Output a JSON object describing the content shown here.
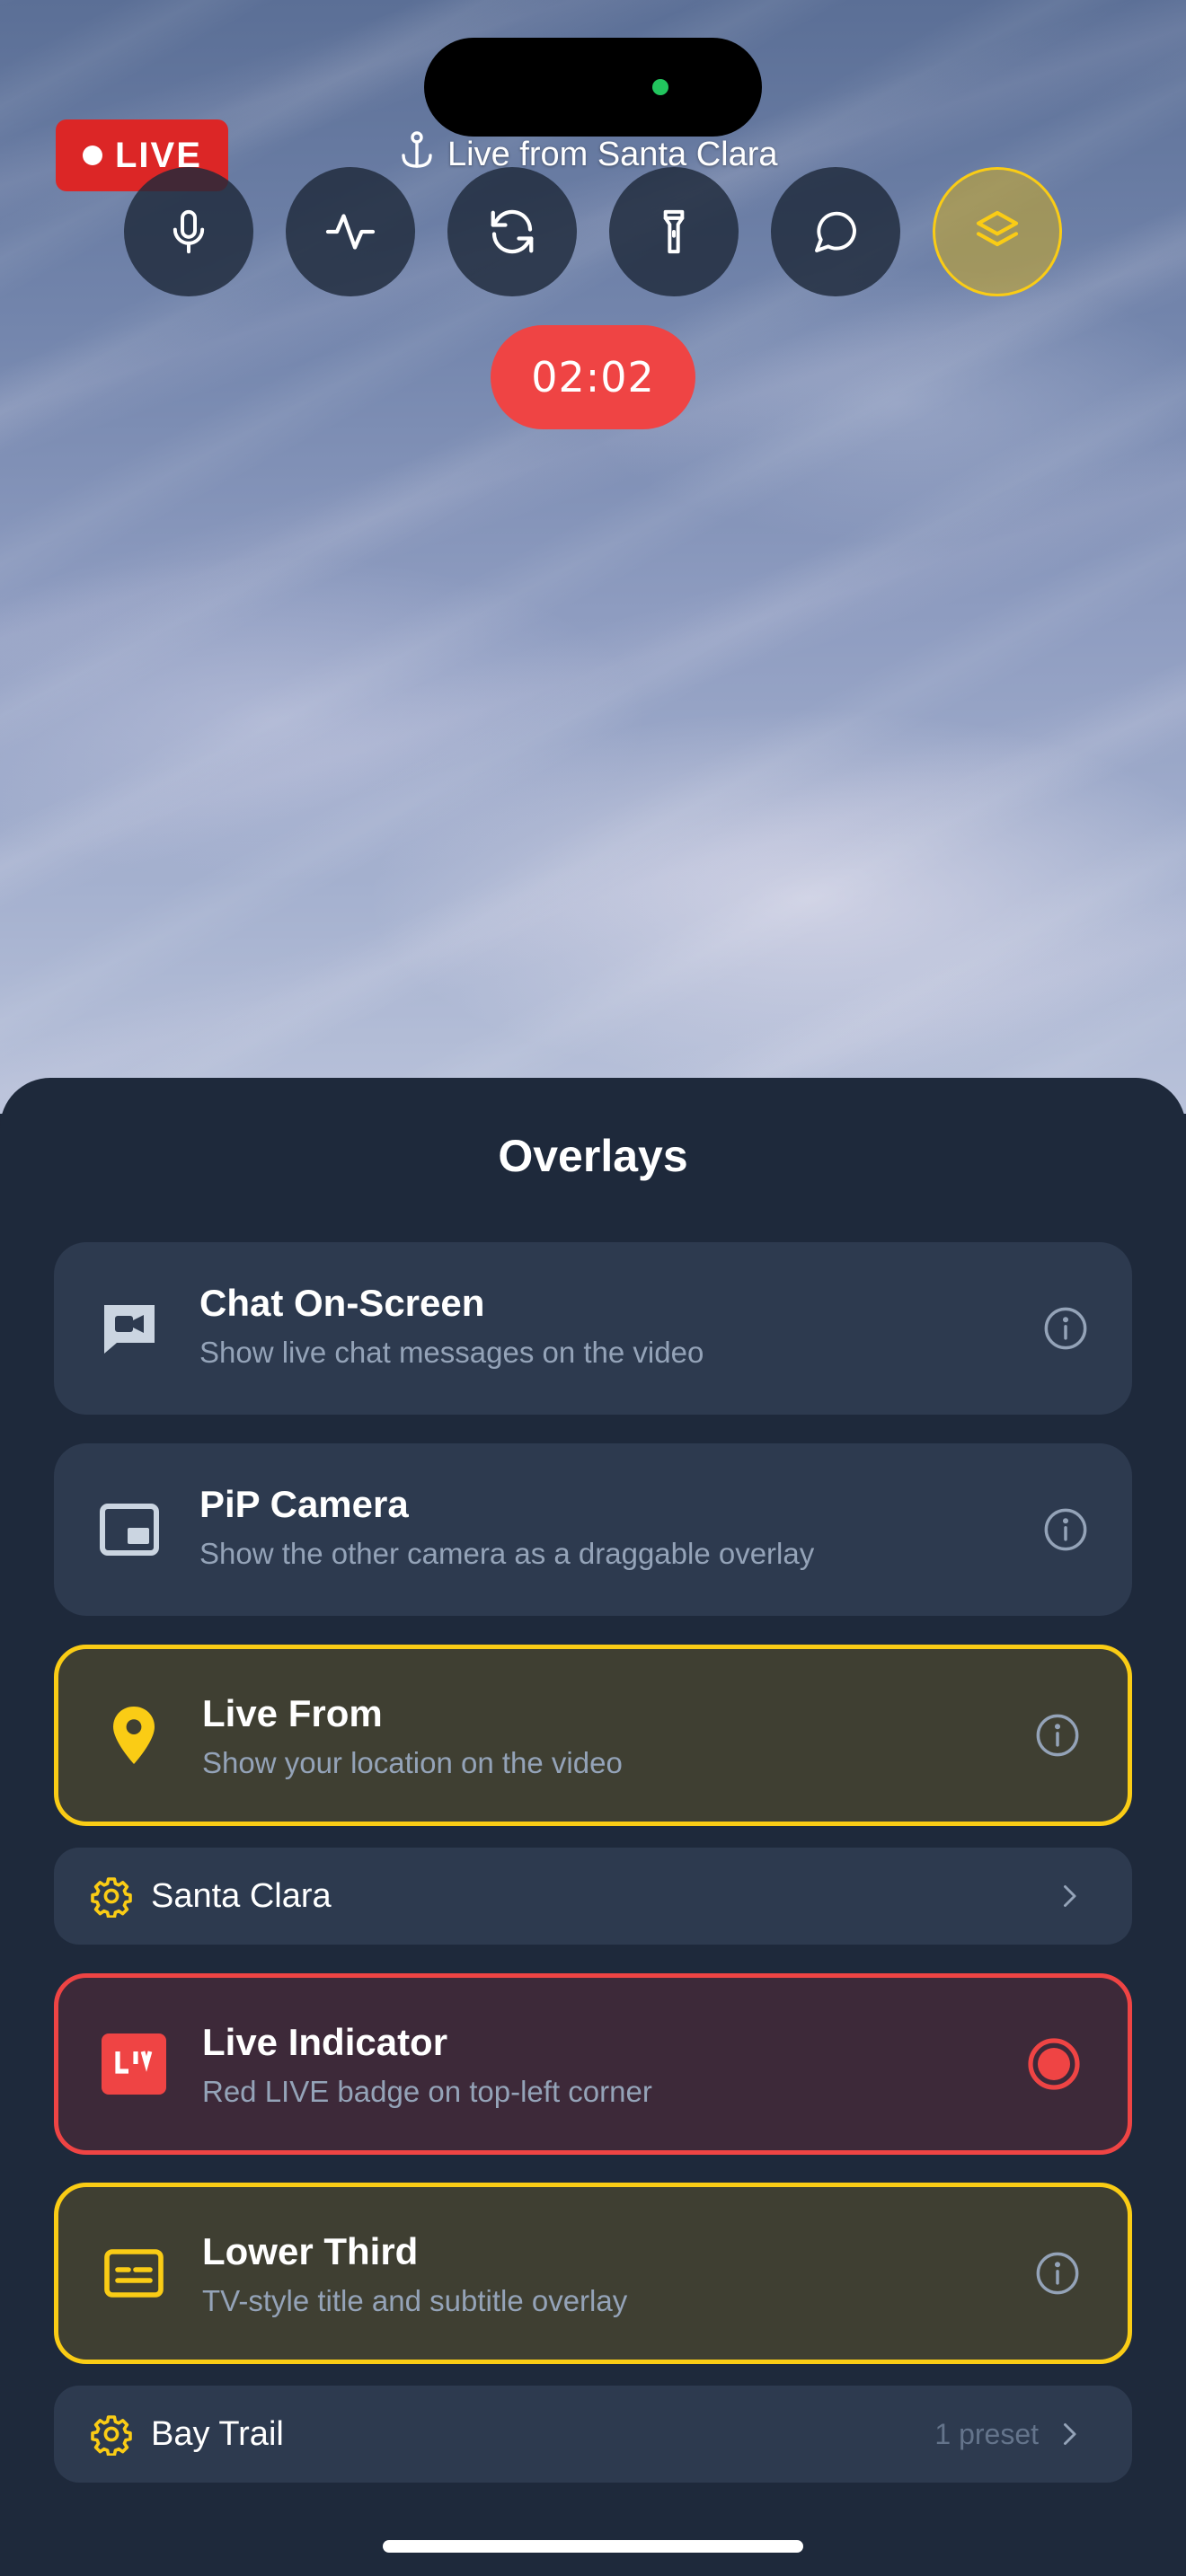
{
  "camera": {
    "live_badge": "LIVE",
    "live_from_text": "Live from Santa Clara",
    "timer": "02:02",
    "controls": [
      {
        "name": "mic",
        "icon": "microphone-icon"
      },
      {
        "name": "audio-levels",
        "icon": "waveform-icon"
      },
      {
        "name": "flip-camera",
        "icon": "rotate-icon"
      },
      {
        "name": "flashlight",
        "icon": "flashlight-icon"
      },
      {
        "name": "chat",
        "icon": "chat-bubble-icon"
      },
      {
        "name": "overlays",
        "icon": "layers-icon",
        "active": true
      }
    ]
  },
  "sheet": {
    "title": "Overlays",
    "items": [
      {
        "title": "Chat On-Screen",
        "subtitle": "Show live chat messages on the video",
        "icon": "chat-video-icon",
        "state": "off"
      },
      {
        "title": "PiP Camera",
        "subtitle": "Show the other camera as a draggable overlay",
        "icon": "pip-icon",
        "state": "off"
      },
      {
        "title": "Live From",
        "subtitle": "Show your location on the video",
        "icon": "location-pin-icon",
        "state": "on"
      },
      {
        "title": "Live Indicator",
        "subtitle": "Red LIVE badge on top-left corner",
        "icon": "live-badge-icon",
        "state": "recording"
      },
      {
        "title": "Lower Third",
        "subtitle": "TV-style title and subtitle overlay",
        "icon": "lower-third-icon",
        "state": "on"
      }
    ],
    "live_from_setting": {
      "label": "Santa Clara"
    },
    "lower_third_setting": {
      "label": "Bay Trail",
      "meta": "1 preset"
    }
  },
  "colors": {
    "accent_yellow": "#facc15",
    "accent_red": "#ef4444",
    "sheet_bg": "#1e293b",
    "card_bg": "#2d3a4f"
  }
}
